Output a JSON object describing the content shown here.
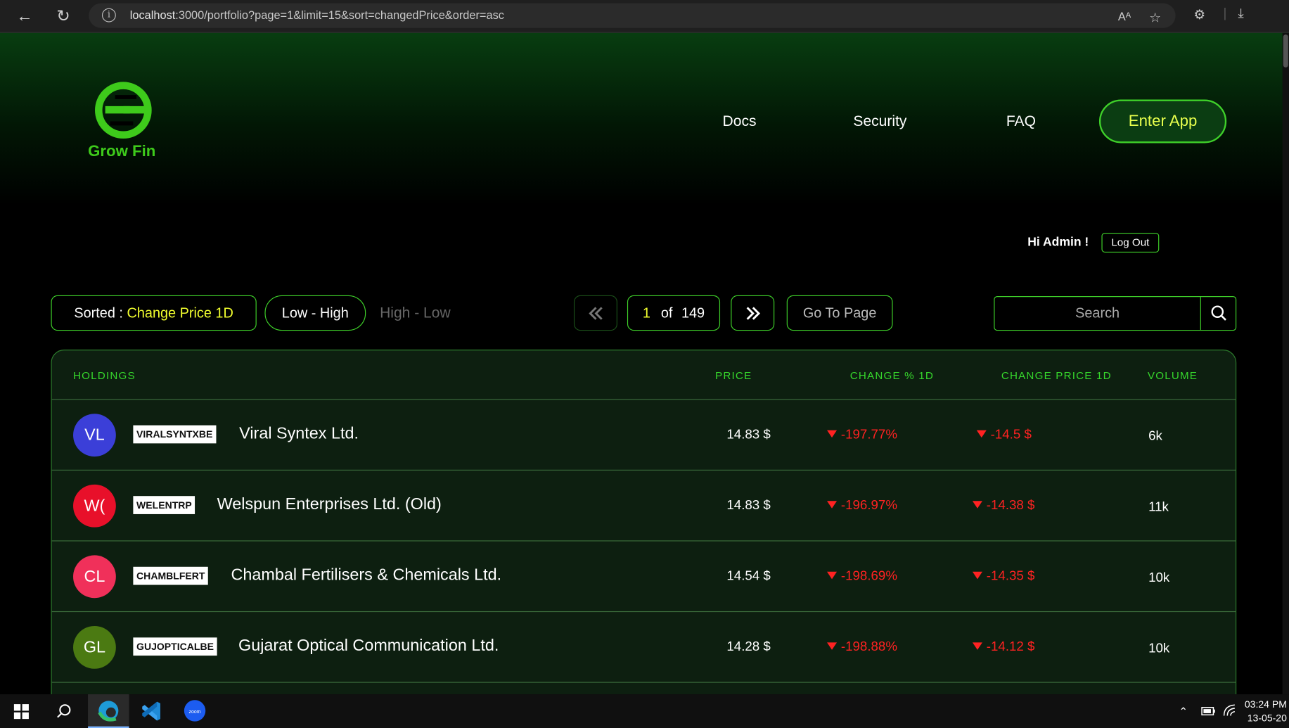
{
  "browser": {
    "url_host": "localhost",
    "url_rest": ":3000/portfolio?page=1&limit=15&sort=changedPrice&order=asc"
  },
  "brand": {
    "name": "Grow Fin",
    "color": "#3ecb1b"
  },
  "nav": {
    "docs": "Docs",
    "security": "Security",
    "faq": "FAQ",
    "enter_app": "Enter App"
  },
  "user": {
    "greeting": "Hi Admin !",
    "logout": "Log Out"
  },
  "controls": {
    "sorted_label": "Sorted :",
    "sorted_value": "Change Price 1D",
    "low_high": "Low - High",
    "high_low": "High - Low",
    "current_page": "1",
    "of_label": "of",
    "total_pages": "149",
    "go_to_page": "Go To Page",
    "search_placeholder": "Search"
  },
  "table": {
    "headers": {
      "holdings": "HOLDINGS",
      "price": "PRICE",
      "change_pct": "CHANGE % 1D",
      "change_price": "CHANGE PRICE 1D",
      "volume": "VOLUME"
    },
    "rows": [
      {
        "initials": "VL",
        "avatar_color": "#3b3fd8",
        "ticker": "VIRALSYNTXBE",
        "name": "Viral Syntex Ltd.",
        "price": "14.83 $",
        "change_pct": "-197.77%",
        "change_price": "-14.5 $",
        "volume": "6k"
      },
      {
        "initials": "W(",
        "avatar_color": "#e8102a",
        "ticker": "WELENTRP",
        "name": "Welspun Enterprises Ltd. (Old)",
        "price": "14.83 $",
        "change_pct": "-196.97%",
        "change_price": "-14.38 $",
        "volume": "11k"
      },
      {
        "initials": "CL",
        "avatar_color": "#f0305a",
        "ticker": "CHAMBLFERT",
        "name": "Chambal Fertilisers & Chemicals Ltd.",
        "price": "14.54 $",
        "change_pct": "-198.69%",
        "change_price": "-14.35 $",
        "volume": "10k"
      },
      {
        "initials": "GL",
        "avatar_color": "#4b7a12",
        "ticker": "GUJOPTICALBE",
        "name": "Gujarat Optical Communication Ltd.",
        "price": "14.28 $",
        "change_pct": "-198.88%",
        "change_price": "-14.12 $",
        "volume": "10k"
      }
    ]
  },
  "taskbar": {
    "time": "03:24 PM",
    "date": "13-05-20"
  }
}
